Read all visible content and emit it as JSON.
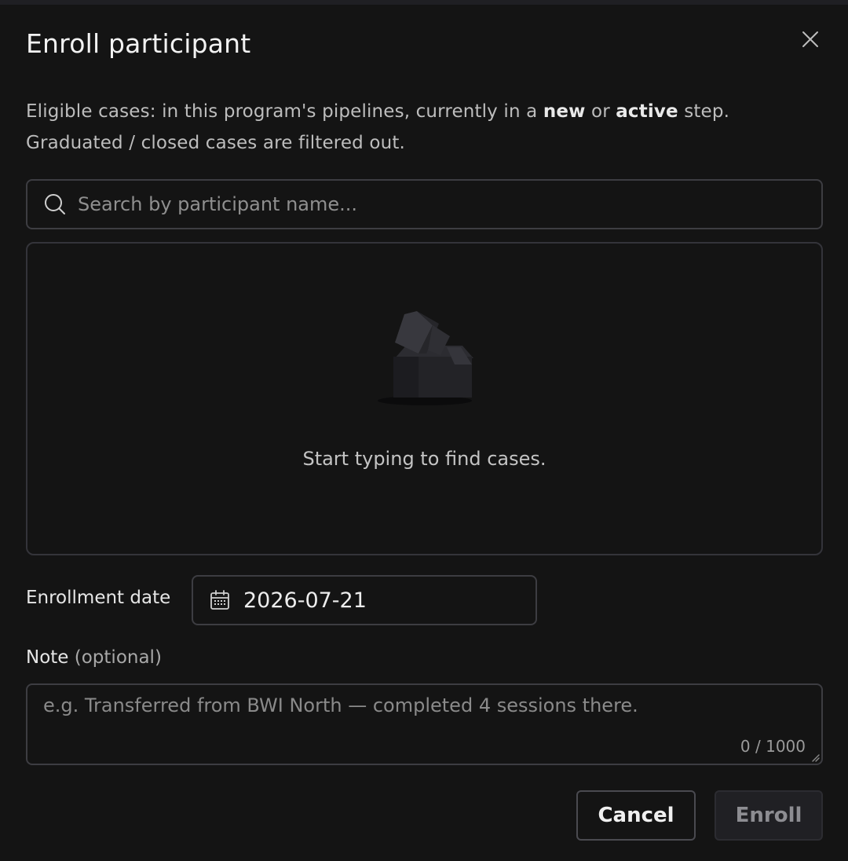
{
  "dialog": {
    "title": "Enroll participant",
    "close_label": "×"
  },
  "description": {
    "prefix": "Eligible cases: in this program's pipelines, currently in a ",
    "bold_new": "new",
    "middle": " or ",
    "bold_active": "active",
    "suffix": " step. Graduated / closed cases are filtered out."
  },
  "search": {
    "placeholder": "Search by participant name...",
    "value": "",
    "icon": "search-icon"
  },
  "results": {
    "empty_message": "Start typing to find cases.",
    "icon": "empty-box-icon"
  },
  "enrollment": {
    "label": "Enrollment date",
    "value": "2026-07-21",
    "icon": "calendar-icon"
  },
  "note": {
    "label": "Note",
    "optional": "(optional)",
    "placeholder": "e.g. Transferred from BWI North — completed 4 sessions there.",
    "value": "",
    "counter": "0 / 1000"
  },
  "actions": {
    "cancel_label": "Cancel",
    "enroll_label": "Enroll"
  },
  "colors": {
    "background": "#141414",
    "border": "#3d3d42",
    "text": "#e6e6e6",
    "muted": "#8f8f8f",
    "disabled_button": "#202024"
  }
}
